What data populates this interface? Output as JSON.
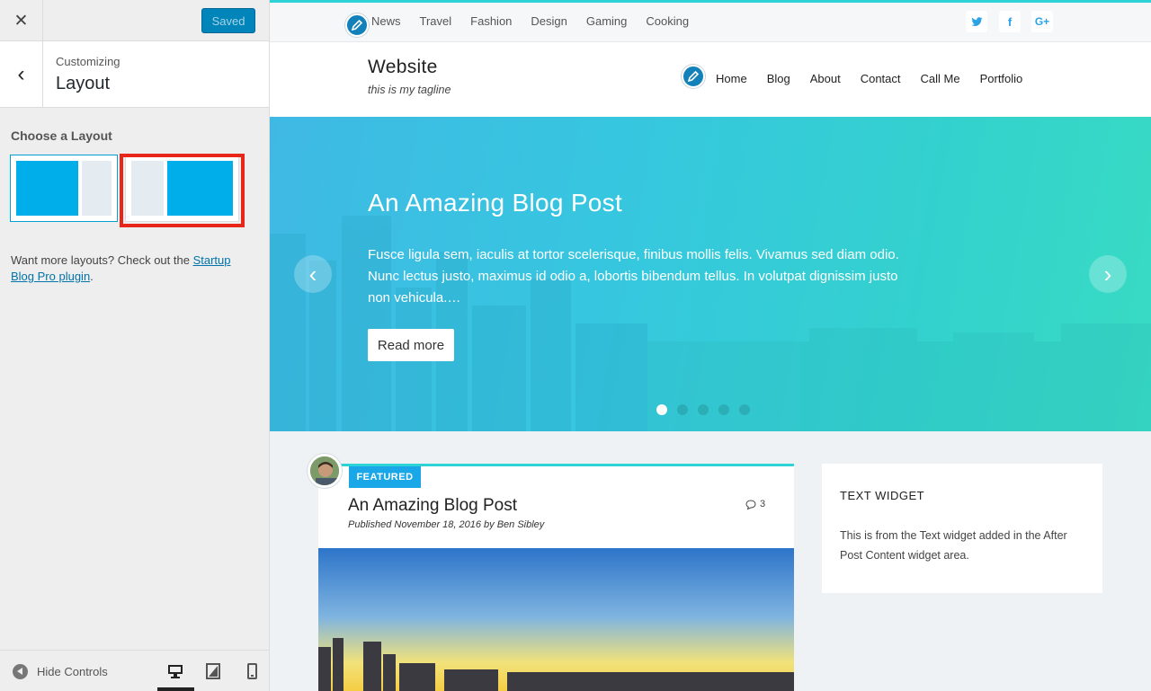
{
  "sidebar": {
    "close_icon": "close-icon",
    "saved_label": "Saved",
    "breadcrumb": "Customizing",
    "section_title": "Layout",
    "choose_label": "Choose a Layout",
    "layout_options": [
      "content-left-sidebar-right",
      "sidebar-left-content-right"
    ],
    "more_text_before": "Want more layouts? Check out the ",
    "more_link": "Startup Blog Pro plugin",
    "more_text_after": ".",
    "hide_controls_label": "Hide Controls",
    "devices": [
      "desktop",
      "tablet",
      "mobile"
    ],
    "active_device": "desktop",
    "colors": {
      "accent": "#0085ba",
      "highlight": "#e8261a",
      "layout_blue": "#00aee9"
    }
  },
  "preview": {
    "secondary_nav": [
      "News",
      "Travel",
      "Fashion",
      "Design",
      "Gaming",
      "Cooking"
    ],
    "social": {
      "twitter": "𝕥",
      "facebook": "f",
      "google_plus": "G+"
    },
    "site_title": "Website",
    "tagline": "this is my tagline",
    "primary_nav": [
      "Home",
      "Blog",
      "About",
      "Contact",
      "Call Me",
      "Portfolio"
    ],
    "hero": {
      "title": "An Amazing Blog Post",
      "excerpt": "Fusce ligula sem, iaculis at tortor scelerisque, finibus mollis felis. Vivamus sed diam odio. Nunc lectus justo, maximus id odio a, lobortis bibendum tellus. In volutpat dignissim justo non vehicula.…",
      "read_more": "Read more",
      "slide_count": 5,
      "active_slide": 1
    },
    "post": {
      "badge": "FEATURED",
      "title": "An Amazing Blog Post",
      "meta": "Published November 18, 2016 by Ben Sibley",
      "comment_count": "3"
    },
    "widget": {
      "title": "TEXT WIDGET",
      "text": "This is from the Text widget added in the After Post Content widget area."
    },
    "colors": {
      "top_border": "#2ed3d8",
      "brand_blue": "#1aa7e8",
      "hero_start": "#3fb9e4",
      "hero_end": "#38dbc3"
    }
  }
}
